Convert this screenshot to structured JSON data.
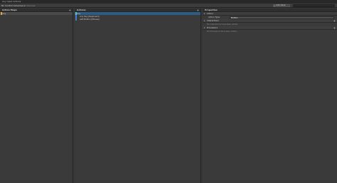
{
  "window": {
    "title": "Any Input Actions"
  },
  "toolbar": {
    "control_scheme": "No Control Schemes",
    "devices": "All Devices",
    "auto_save": "Auto-Save"
  },
  "action_maps": {
    "header": "Action Maps",
    "items": [
      {
        "label": "Any"
      }
    ]
  },
  "actions": {
    "header": "Actions",
    "items": [
      {
        "label": "Any",
        "kind": "action"
      },
      {
        "label": "Any Key [Keyboard]",
        "kind": "binding"
      },
      {
        "label": "Left Button [Mouse]",
        "kind": "binding"
      }
    ]
  },
  "properties": {
    "header": "Properties",
    "action_section": "Action",
    "action_type_label": "Action Type",
    "action_type_value": "Button",
    "interactions_section": "Interactions",
    "interactions_empty": "No Interactions have been added.",
    "processors_section": "Processors",
    "processors_empty": "No Processors have been added."
  },
  "colors": {
    "map_tag": "#e8a33d",
    "action_tag": "#59c1b5",
    "binding_tag": "#3c7ec6",
    "selection": "#2c5d87"
  }
}
